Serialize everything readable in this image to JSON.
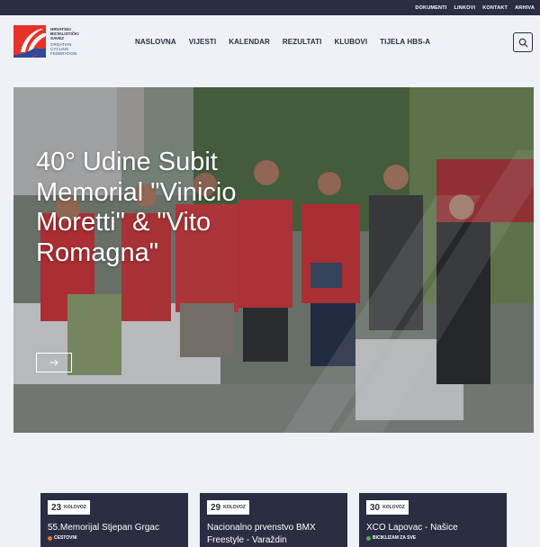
{
  "topbar": {
    "links": [
      "DOKUMENTI",
      "LINKOVI",
      "KONTAKT",
      "ARHIVA"
    ]
  },
  "logo": {
    "line1": "HRVATSKI",
    "line2": "BICIKLISTIČKI",
    "line3": "SAVEZ",
    "sub1": "CROATIAN",
    "sub2": "CYCLING",
    "sub3": "FEDERATION",
    "icon": "hbs-logo"
  },
  "nav": {
    "items": [
      "NASLOVNA",
      "VIJESTI",
      "KALENDAR",
      "REZULTATI",
      "KLUBOVI",
      "TIJELA HBS-A"
    ],
    "search_icon": "search-icon"
  },
  "hero": {
    "title": "40° Udine Subit Memorial \"Vinicio Moretti\" & \"Vito Romagna\"",
    "arrow_icon": "arrow-right-icon"
  },
  "events": [
    {
      "day": "23",
      "month": "KOLOVOZ",
      "title": "55.Memorijal Stjepan Grgac",
      "tag": "CESTOVNI",
      "tag_color": "#e0762b"
    },
    {
      "day": "29",
      "month": "KOLOVOZ",
      "title": "Nacionalno prvenstvo BMX Freestyle - Varaždin",
      "tag": "",
      "tag_color": "#e0762b"
    },
    {
      "day": "30",
      "month": "KOLOVOZ",
      "title": "XCO Lapovac - Našice",
      "tag": "BICIKLIZAM ZA SVE",
      "tag_color": "#4caf50"
    }
  ],
  "colors": {
    "dark": "#2b2d42",
    "background": "#eef1f5",
    "brand_red": "#e5332a",
    "brand_blue": "#2b4a9b"
  }
}
